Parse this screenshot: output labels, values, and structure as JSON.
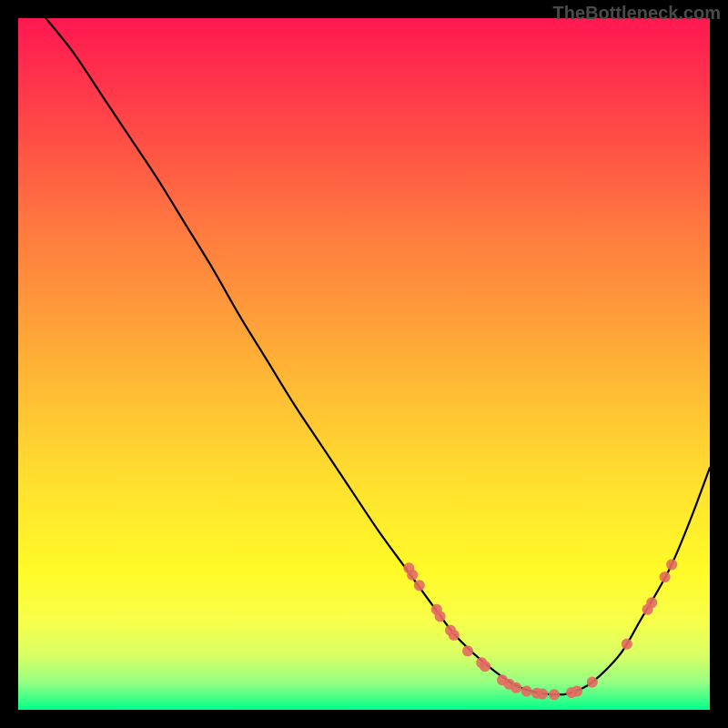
{
  "watermark": "TheBottleneck.com",
  "chart_data": {
    "type": "line",
    "title": "",
    "xlabel": "",
    "ylabel": "",
    "xlim": [
      0,
      100
    ],
    "ylim": [
      0,
      100
    ],
    "note": "Axis values are estimated from pixel positions; the chart has no visible tick labels.",
    "series": [
      {
        "name": "curve",
        "x": [
          4,
          8,
          12,
          16,
          20,
          24,
          28,
          32,
          36,
          40,
          44,
          48,
          52,
          56,
          60,
          63,
          66,
          69,
          72,
          75,
          78,
          80,
          83,
          87,
          90,
          94,
          97,
          100
        ],
        "y": [
          100,
          95,
          89,
          83,
          77,
          70.5,
          64,
          57,
          50.5,
          44,
          38,
          32,
          26,
          20.5,
          15,
          11,
          8,
          5.5,
          3.5,
          2.5,
          2.2,
          2.5,
          4,
          8,
          13,
          20,
          27,
          35
        ]
      }
    ],
    "markers": {
      "name": "highlight-points",
      "points": [
        {
          "x": 56.5,
          "y": 20.5
        },
        {
          "x": 57.0,
          "y": 19.5
        },
        {
          "x": 58.0,
          "y": 18.0
        },
        {
          "x": 60.5,
          "y": 14.5
        },
        {
          "x": 61.0,
          "y": 13.5
        },
        {
          "x": 62.5,
          "y": 11.5
        },
        {
          "x": 63.0,
          "y": 10.8
        },
        {
          "x": 65.0,
          "y": 8.5
        },
        {
          "x": 67.0,
          "y": 6.8
        },
        {
          "x": 67.5,
          "y": 6.3
        },
        {
          "x": 70.0,
          "y": 4.3
        },
        {
          "x": 71.0,
          "y": 3.7
        },
        {
          "x": 72.0,
          "y": 3.2
        },
        {
          "x": 73.5,
          "y": 2.7
        },
        {
          "x": 75.0,
          "y": 2.4
        },
        {
          "x": 75.8,
          "y": 2.3
        },
        {
          "x": 77.5,
          "y": 2.2
        },
        {
          "x": 80.0,
          "y": 2.5
        },
        {
          "x": 80.8,
          "y": 2.7
        },
        {
          "x": 83.0,
          "y": 4.0
        },
        {
          "x": 88.0,
          "y": 9.5
        },
        {
          "x": 91.0,
          "y": 14.5
        },
        {
          "x": 91.6,
          "y": 15.5
        },
        {
          "x": 93.5,
          "y": 19.2
        },
        {
          "x": 94.5,
          "y": 21.0
        }
      ]
    }
  }
}
